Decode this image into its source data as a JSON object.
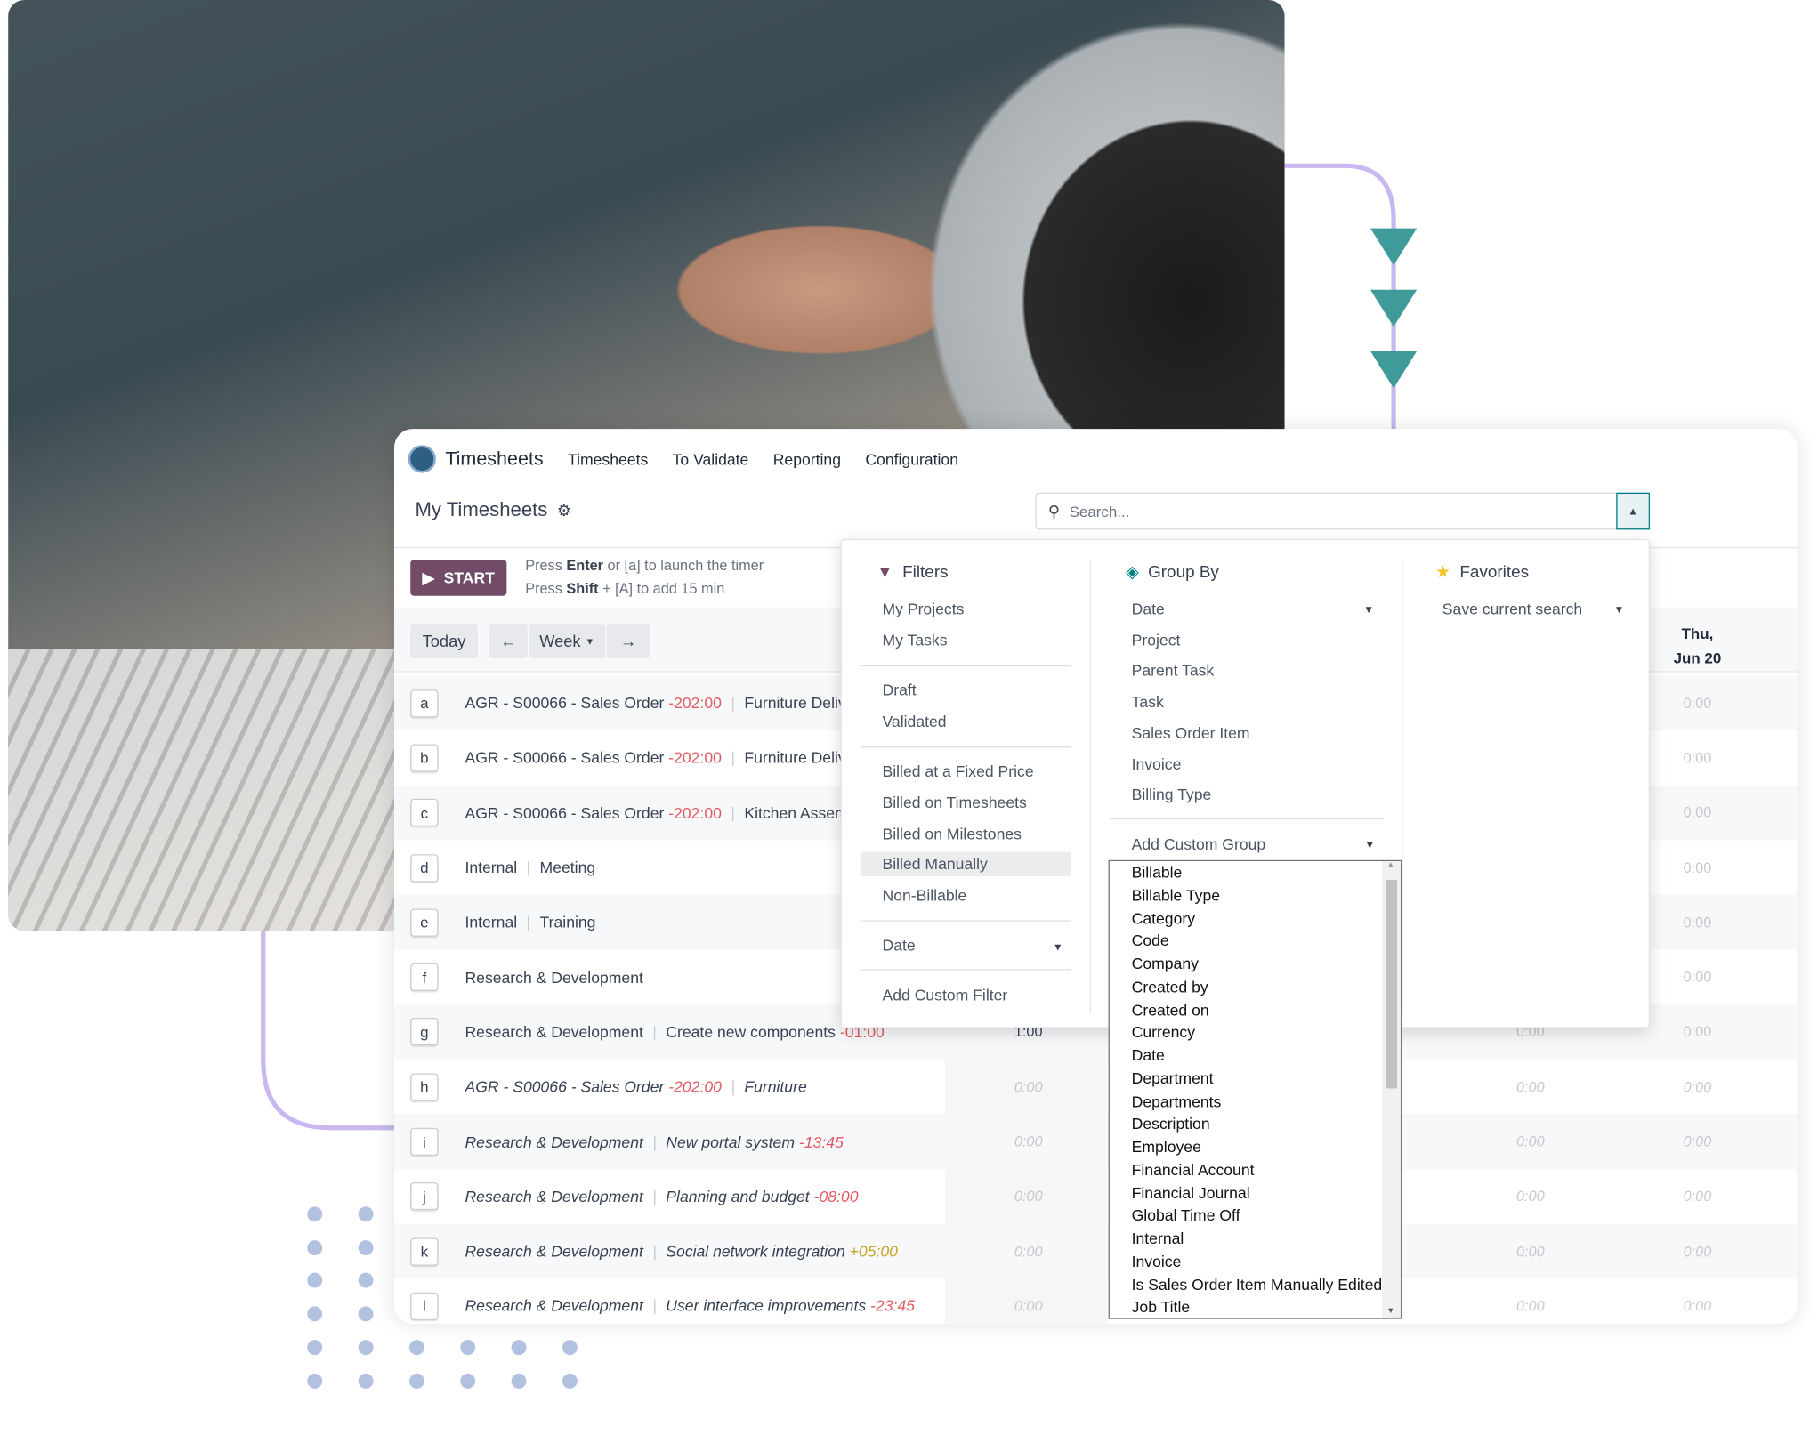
{
  "app": {
    "name": "Timesheets",
    "menu": [
      "Timesheets",
      "To Validate",
      "Reporting",
      "Configuration"
    ]
  },
  "page": {
    "title": "My Timesheets"
  },
  "search": {
    "placeholder": "Search..."
  },
  "timer": {
    "start_label": "START",
    "hint1_a": "Press ",
    "hint1_key": "Enter",
    "hint1_b": " or [a] to launch the timer",
    "hint2_a": "Press ",
    "hint2_key": "Shift",
    "hint2_b": " + [A] to add 15 min"
  },
  "toolbar": {
    "today": "Today",
    "prev": "←",
    "period": "Week",
    "next": "→"
  },
  "columns": {
    "last_day": "Thu,",
    "last_date": "Jun 20"
  },
  "rows": [
    {
      "key": "a",
      "project": "AGR - S00066 - Sales Order",
      "project_hours": "-202:00",
      "task": "Furniture Deliv",
      "italic": false,
      "c1": "",
      "c2": "",
      "c3": "0:00"
    },
    {
      "key": "b",
      "project": "AGR - S00066 - Sales Order",
      "project_hours": "-202:00",
      "task": "Furniture Deliv",
      "italic": false,
      "c1": "",
      "c2": "",
      "c3": "0:00"
    },
    {
      "key": "c",
      "project": "AGR - S00066 - Sales Order",
      "project_hours": "-202:00",
      "task": "Kitchen Assem",
      "italic": false,
      "c1": "",
      "c2": "",
      "c3": "0:00"
    },
    {
      "key": "d",
      "project": "Internal",
      "project_hours": "",
      "task": "Meeting",
      "italic": false,
      "c1": "",
      "c2": "",
      "c3": "0:00"
    },
    {
      "key": "e",
      "project": "Internal",
      "project_hours": "",
      "task": "Training",
      "italic": false,
      "c1": "",
      "c2": "",
      "c3": "0:00"
    },
    {
      "key": "f",
      "project": "Research & Development",
      "project_hours": "",
      "task": "",
      "italic": false,
      "c1": "",
      "c2": "",
      "c3": "0:00"
    },
    {
      "key": "g",
      "project": "Research & Development",
      "project_hours": "",
      "task": "Create new components",
      "task_hours": "-01:00",
      "italic": false,
      "c1": "1:00",
      "c2": "0:00",
      "c3": "0:00"
    },
    {
      "key": "h",
      "project": "AGR - S00066 - Sales Order",
      "project_hours": "-202:00",
      "task": "Furniture",
      "italic": true,
      "c1": "0:00",
      "c2": "0:00",
      "c3": "0:00"
    },
    {
      "key": "i",
      "project": "Research & Development",
      "project_hours": "",
      "task": "New portal system",
      "task_hours": "-13:45",
      "italic": true,
      "c1": "0:00",
      "c2": "0:00",
      "c3": "0:00"
    },
    {
      "key": "j",
      "project": "Research & Development",
      "project_hours": "",
      "task": "Planning and budget",
      "task_hours": "-08:00",
      "italic": true,
      "c1": "0:00",
      "c2": "0:00",
      "c3": "0:00"
    },
    {
      "key": "k",
      "project": "Research & Development",
      "project_hours": "",
      "task": "Social network integration",
      "task_hours": "+05:00",
      "italic": true,
      "c1": "0:00",
      "c2": "0:00",
      "c3": "0:00"
    },
    {
      "key": "l",
      "project": "Research & Development",
      "project_hours": "",
      "task": "User interface improvements",
      "task_hours": "-23:45",
      "italic": true,
      "c1": "0:00",
      "c2": "0:00",
      "c3": "0:00"
    }
  ],
  "filters": {
    "title": "Filters",
    "group1": [
      "My Projects",
      "My Tasks"
    ],
    "group2": [
      "Draft",
      "Validated"
    ],
    "group3": [
      "Billed at a Fixed Price",
      "Billed on Timesheets",
      "Billed on Milestones",
      "Billed Manually",
      "Non-Billable"
    ],
    "highlighted": "Billed Manually",
    "date": "Date",
    "custom": "Add Custom Filter"
  },
  "group_by": {
    "title": "Group By",
    "items": [
      "Date",
      "Project",
      "Parent Task",
      "Task",
      "Sales Order Item",
      "Invoice",
      "Billing Type"
    ],
    "custom": "Add Custom Group",
    "options": [
      "Billable",
      "Billable Type",
      "Category",
      "Code",
      "Company",
      "Created by",
      "Created on",
      "Currency",
      "Date",
      "Department",
      "Departments",
      "Description",
      "Employee",
      "Financial Account",
      "Financial Journal",
      "Global Time Off",
      "Internal",
      "Invoice",
      "Is Sales Order Item Manually Edited",
      "Job Title"
    ]
  },
  "favorites": {
    "title": "Favorites",
    "save": "Save current search"
  },
  "colors": {
    "primary": "#714b67",
    "accent": "#017e84",
    "negative": "#e05a63",
    "positive": "#c9a227",
    "decor_line": "#c9b8f0",
    "decor_triangle": "#3f9a9a",
    "decor_dots": "#b3c1e0"
  }
}
